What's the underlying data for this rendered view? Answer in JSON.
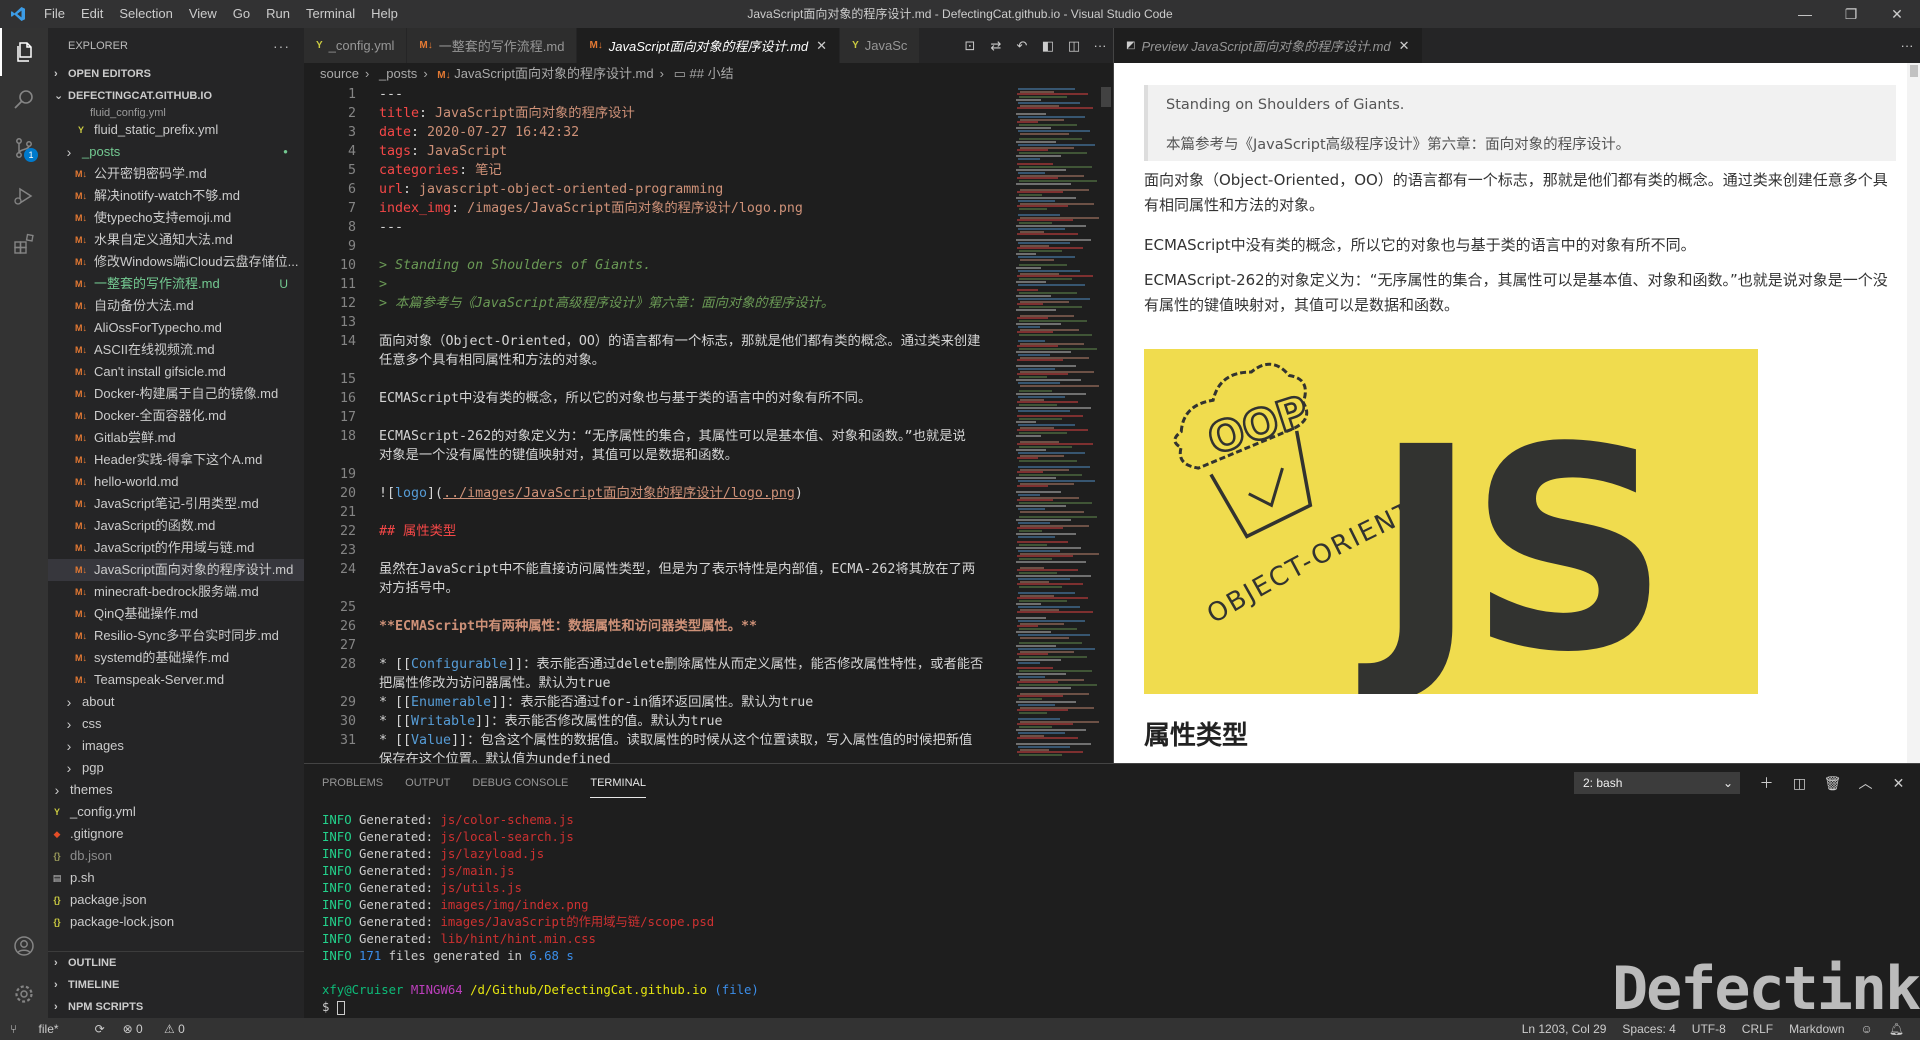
{
  "window": {
    "title": "JavaScript面向对象的程序设计.md - DefectingCat.github.io - Visual Studio Code",
    "menu": [
      "File",
      "Edit",
      "Selection",
      "View",
      "Go",
      "Run",
      "Terminal",
      "Help"
    ],
    "controls": [
      "minimize-icon",
      "restore-icon",
      "close-icon"
    ]
  },
  "activity_bar": {
    "items": [
      "explorer-icon",
      "search-icon",
      "source-control-icon",
      "run-debug-icon",
      "extensions-icon"
    ],
    "scm_badge": "1",
    "bottom": [
      "account-icon",
      "settings-gear-icon"
    ]
  },
  "sidebar": {
    "title": "EXPLORER",
    "open_editors": "OPEN EDITORS",
    "workspace": "DEFECTINGCAT.GITHUB.IO",
    "partial_item": "fluid_config.yml",
    "files": [
      {
        "name": "fluid_static_prefix.yml",
        "type": "yml",
        "level": 1
      },
      {
        "name": "_posts",
        "type": "folder",
        "level": 0,
        "flag": "●",
        "color": "#73c991"
      },
      {
        "name": "公开密钥密码学.md",
        "type": "md",
        "level": 1
      },
      {
        "name": "解决inotify-watch不够.md",
        "type": "md",
        "level": 1
      },
      {
        "name": "使typecho支持emoji.md",
        "type": "md",
        "level": 1
      },
      {
        "name": "水果自定义通知大法.md",
        "type": "md",
        "level": 1
      },
      {
        "name": "修改Windows端iCloud云盘存储位...",
        "type": "md",
        "level": 1
      },
      {
        "name": "一整套的写作流程.md",
        "type": "md",
        "level": 1,
        "flag": "U",
        "color": "#73c991"
      },
      {
        "name": "自动备份大法.md",
        "type": "md",
        "level": 1
      },
      {
        "name": "AliOssForTypecho.md",
        "type": "md",
        "level": 1
      },
      {
        "name": "ASCII在线视频流.md",
        "type": "md",
        "level": 1
      },
      {
        "name": "Can't install gifsicle.md",
        "type": "md",
        "level": 1
      },
      {
        "name": "Docker-构建属于自己的镜像.md",
        "type": "md",
        "level": 1
      },
      {
        "name": "Docker-全面容器化.md",
        "type": "md",
        "level": 1
      },
      {
        "name": "Gitlab尝鲜.md",
        "type": "md",
        "level": 1
      },
      {
        "name": "Header实践-得拿下这个A.md",
        "type": "md",
        "level": 1
      },
      {
        "name": "hello-world.md",
        "type": "md",
        "level": 1
      },
      {
        "name": "JavaScript笔记-引用类型.md",
        "type": "md",
        "level": 1
      },
      {
        "name": "JavaScript的函数.md",
        "type": "md",
        "level": 1
      },
      {
        "name": "JavaScript的作用域与链.md",
        "type": "md",
        "level": 1
      },
      {
        "name": "JavaScript面向对象的程序设计.md",
        "type": "md",
        "level": 1,
        "selected": true
      },
      {
        "name": "minecraft-bedrock服务端.md",
        "type": "md",
        "level": 1
      },
      {
        "name": "QinQ基础操作.md",
        "type": "md",
        "level": 1
      },
      {
        "name": "Resilio-Sync多平台实时同步.md",
        "type": "md",
        "level": 1
      },
      {
        "name": "systemd的基础操作.md",
        "type": "md",
        "level": 1
      },
      {
        "name": "Teamspeak-Server.md",
        "type": "md",
        "level": 1
      },
      {
        "name": "about",
        "type": "folder",
        "level": 0
      },
      {
        "name": "css",
        "type": "folder",
        "level": 0
      },
      {
        "name": "images",
        "type": "folder",
        "level": 0
      },
      {
        "name": "pgp",
        "type": "folder",
        "level": 0
      },
      {
        "name": "themes",
        "type": "folder",
        "level": -1
      },
      {
        "name": "_config.yml",
        "type": "yml",
        "level": -1
      },
      {
        "name": ".gitignore",
        "type": "git",
        "level": -1
      },
      {
        "name": "db.json",
        "type": "json-dim",
        "level": -1
      },
      {
        "name": "p.sh",
        "type": "sh",
        "level": -1
      },
      {
        "name": "package.json",
        "type": "json",
        "level": -1
      },
      {
        "name": "package-lock.json",
        "type": "json",
        "level": -1
      }
    ],
    "bottom_sections": [
      "OUTLINE",
      "TIMELINE",
      "NPM SCRIPTS"
    ]
  },
  "editor": {
    "tabs": [
      {
        "label": "_config.yml",
        "icon": "yml",
        "active": false
      },
      {
        "label": "一整套的写作流程.md",
        "icon": "md",
        "active": false
      },
      {
        "label": "JavaScript面向对象的程序设计.md",
        "icon": "md",
        "active": true
      },
      {
        "label": "JavaSc",
        "icon": "yml",
        "active": false
      }
    ],
    "breadcrumb": [
      "source",
      "_posts",
      "JavaScript面向对象的程序设计.md",
      "## 小结"
    ],
    "lines": [
      {
        "n": "1",
        "parts": [
          {
            "c": "k-dash",
            "t": "---"
          }
        ]
      },
      {
        "n": "2",
        "parts": [
          {
            "c": "k-key",
            "t": "title"
          },
          {
            "c": "k-norm",
            "t": ": "
          },
          {
            "c": "k-val",
            "t": "JavaScript面向对象的程序设计"
          }
        ]
      },
      {
        "n": "3",
        "parts": [
          {
            "c": "k-key",
            "t": "date"
          },
          {
            "c": "k-norm",
            "t": ": "
          },
          {
            "c": "k-val",
            "t": "2020-07-27 16:42:32"
          }
        ]
      },
      {
        "n": "4",
        "parts": [
          {
            "c": "k-key",
            "t": "tags"
          },
          {
            "c": "k-norm",
            "t": ": "
          },
          {
            "c": "k-val",
            "t": "JavaScript"
          }
        ]
      },
      {
        "n": "5",
        "parts": [
          {
            "c": "k-key",
            "t": "categories"
          },
          {
            "c": "k-norm",
            "t": ": "
          },
          {
            "c": "k-val",
            "t": "笔记"
          }
        ]
      },
      {
        "n": "6",
        "parts": [
          {
            "c": "k-key",
            "t": "url"
          },
          {
            "c": "k-norm",
            "t": ": "
          },
          {
            "c": "k-val",
            "t": "javascript-object-oriented-programming"
          }
        ]
      },
      {
        "n": "7",
        "parts": [
          {
            "c": "k-key",
            "t": "index_img"
          },
          {
            "c": "k-norm",
            "t": ": "
          },
          {
            "c": "k-val",
            "t": "/images/JavaScript面向对象的程序设计/logo.png"
          }
        ]
      },
      {
        "n": "8",
        "parts": [
          {
            "c": "k-dash",
            "t": "---"
          }
        ]
      },
      {
        "n": "9",
        "parts": []
      },
      {
        "n": "10",
        "parts": [
          {
            "c": "k-quote",
            "t": "> Standing on Shoulders of Giants."
          }
        ]
      },
      {
        "n": "11",
        "parts": [
          {
            "c": "k-quote",
            "t": ">"
          }
        ]
      },
      {
        "n": "12",
        "parts": [
          {
            "c": "k-quote",
            "t": "> 本篇参考与《JavaScript高级程序设计》第六章：面向对象的程序设计。"
          }
        ]
      },
      {
        "n": "13",
        "parts": []
      },
      {
        "n": "14",
        "parts": [
          {
            "c": "k-norm",
            "t": "面向对象（Object-Oriented，OO）的语言都有一个标志，那就是他们都有类的概念。通过类来创建"
          }
        ]
      },
      {
        "n": "",
        "parts": [
          {
            "c": "k-norm",
            "t": "任意多个具有相同属性和方法的对象。"
          }
        ]
      },
      {
        "n": "15",
        "parts": []
      },
      {
        "n": "16",
        "parts": [
          {
            "c": "k-norm",
            "t": "ECMAScript中没有类的概念，所以它的对象也与基于类的语言中的对象有所不同。"
          }
        ]
      },
      {
        "n": "17",
        "parts": []
      },
      {
        "n": "18",
        "parts": [
          {
            "c": "k-norm",
            "t": "ECMAScript-262的对象定义为：“无序属性的集合，其属性可以是基本值、对象和函数。”也就是说"
          }
        ]
      },
      {
        "n": "",
        "parts": [
          {
            "c": "k-norm",
            "t": "对象是一个没有属性的键值映射对，其值可以是数据和函数。"
          }
        ]
      },
      {
        "n": "19",
        "parts": []
      },
      {
        "n": "20",
        "parts": [
          {
            "c": "k-norm",
            "t": "!["
          },
          {
            "c": "k-bracket",
            "t": "logo"
          },
          {
            "c": "k-norm",
            "t": "]("
          },
          {
            "c": "k-link",
            "t": "../images/JavaScript面向对象的程序设计/logo.png"
          },
          {
            "c": "k-norm",
            "t": ")"
          }
        ]
      },
      {
        "n": "21",
        "parts": []
      },
      {
        "n": "22",
        "parts": [
          {
            "c": "k-head",
            "t": "## 属性类型"
          }
        ]
      },
      {
        "n": "23",
        "parts": []
      },
      {
        "n": "24",
        "parts": [
          {
            "c": "k-norm",
            "t": "虽然在JavaScript中不能直接访问属性类型，但是为了表示特性是内部值，ECMA-262将其放在了两"
          }
        ]
      },
      {
        "n": "",
        "parts": [
          {
            "c": "k-norm",
            "t": "对方括号中。"
          }
        ]
      },
      {
        "n": "25",
        "parts": []
      },
      {
        "n": "26",
        "parts": [
          {
            "c": "k-bold",
            "t": "**ECMAScript中有两种属性：数据属性和访问器类型属性。**"
          }
        ]
      },
      {
        "n": "27",
        "parts": []
      },
      {
        "n": "28",
        "parts": [
          {
            "c": "k-norm",
            "t": "* [["
          },
          {
            "c": "k-bracket",
            "t": "Configurable"
          },
          {
            "c": "k-norm",
            "t": "]]：表示能否通过delete删除属性从而定义属性，能否修改属性特性，或者能否"
          }
        ]
      },
      {
        "n": "",
        "parts": [
          {
            "c": "k-norm",
            "t": "把属性修改为访问器属性。默认为true"
          }
        ]
      },
      {
        "n": "29",
        "parts": [
          {
            "c": "k-norm",
            "t": "* [["
          },
          {
            "c": "k-bracket",
            "t": "Enumerable"
          },
          {
            "c": "k-norm",
            "t": "]]：表示能否通过for-in循环返回属性。默认为true"
          }
        ]
      },
      {
        "n": "30",
        "parts": [
          {
            "c": "k-norm",
            "t": "* [["
          },
          {
            "c": "k-bracket",
            "t": "Writable"
          },
          {
            "c": "k-norm",
            "t": "]]：表示能否修改属性的值。默认为true"
          }
        ]
      },
      {
        "n": "31",
        "parts": [
          {
            "c": "k-norm",
            "t": "* [["
          },
          {
            "c": "k-bracket",
            "t": "Value"
          },
          {
            "c": "k-norm",
            "t": "]]：包含这个属性的数据值。读取属性的时候从这个位置读取，写入属性值的时候把新值"
          }
        ]
      },
      {
        "n": "",
        "parts": [
          {
            "c": "k-norm",
            "t": "保存在这个位置。默认值为undefined"
          }
        ]
      }
    ]
  },
  "preview": {
    "tab_label": "Preview JavaScript面向对象的程序设计.md",
    "quote": [
      "Standing on Shoulders of Giants.",
      "本篇参考与《JavaScript高级程序设计》第六章：面向对象的程序设计。"
    ],
    "paragraphs": [
      "面向对象（Object-Oriented，OO）的语言都有一个标志，那就是他们都有类的概念。通过类来创建任意多个具有相同属性和方法的对象。",
      "ECMAScript中没有类的概念，所以它的对象也与基于类的语言中的对象有所不同。",
      "ECMAScript-262的对象定义为：“无序属性的集合，其属性可以是基本值、对象和函数。”也就是说对象是一个没有属性的键值映射对，其值可以是数据和函数。"
    ],
    "image": {
      "badge_text": "OOP",
      "arc_text": "OBJECT-ORIENTED",
      "big_text": "JS",
      "bg_color": "#f0dc4e",
      "fg_color": "#323330"
    },
    "heading": "属性类型"
  },
  "panel": {
    "tabs": [
      "PROBLEMS",
      "OUTPUT",
      "DEBUG CONSOLE",
      "TERMINAL"
    ],
    "active_tab": "TERMINAL",
    "terminal_select": "2: bash",
    "actions": [
      "add-icon",
      "split-icon",
      "trash-icon",
      "maximize-icon",
      "close-icon"
    ],
    "terminal_lines": [
      {
        "level": "INFO",
        "label": "Generated:",
        "file": "js/color-schema.js"
      },
      {
        "level": "INFO",
        "label": "Generated:",
        "file": "js/local-search.js"
      },
      {
        "level": "INFO",
        "label": "Generated:",
        "file": "js/lazyload.js"
      },
      {
        "level": "INFO",
        "label": "Generated:",
        "file": "js/main.js"
      },
      {
        "level": "INFO",
        "label": "Generated:",
        "file": "js/utils.js"
      },
      {
        "level": "INFO",
        "label": "Generated:",
        "file": "images/img/index.png"
      },
      {
        "level": "INFO",
        "label": "Generated:",
        "file": "images/JavaScript的作用域与链/scope.psd"
      },
      {
        "level": "INFO",
        "label": "Generated:",
        "file": "lib/hint/hint.min.css"
      }
    ],
    "summary": {
      "level": "INFO",
      "count": "171",
      "text_mid": "files generated in",
      "seconds": "6.68",
      "unit": "s"
    },
    "prompt": {
      "user": "xfy@Cruiser",
      "shell": "MINGW64",
      "path": "/d/Github/DefectingCat.github.io",
      "branch": "(file)",
      "symbol": "$"
    },
    "watermark": "Defectink"
  },
  "statusbar": {
    "branch": "file*",
    "sync": "⟳",
    "errors": "⊗ 0",
    "warnings": "⚠ 0",
    "position": "Ln 1203, Col 29",
    "spaces": "Spaces: 4",
    "encoding": "UTF-8",
    "eol": "CRLF",
    "language": "Markdown"
  }
}
